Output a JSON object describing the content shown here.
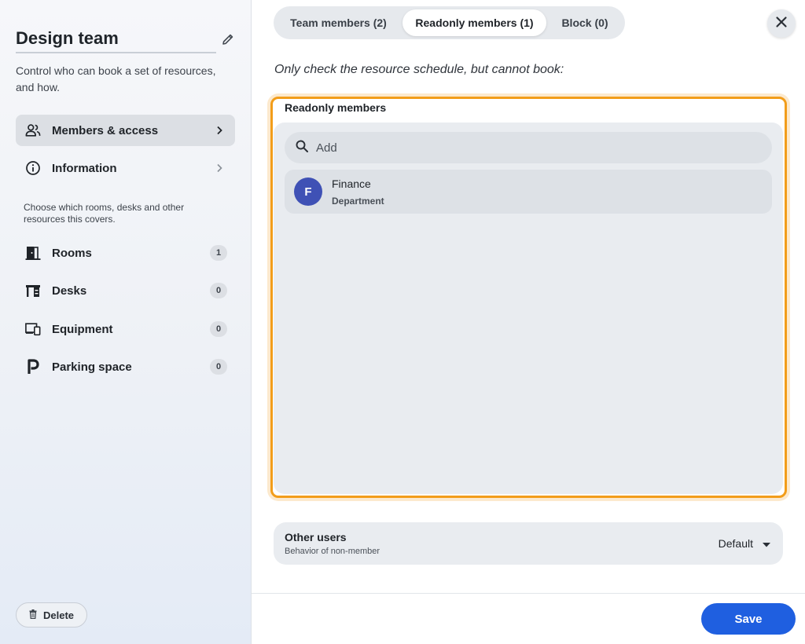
{
  "sidebar": {
    "title": "Design team",
    "subtitle": "Control who can book a set of resources, and how.",
    "nav": [
      {
        "label": "Members & access",
        "icon": "people-icon",
        "active": true
      },
      {
        "label": "Information",
        "icon": "info-icon",
        "active": false
      }
    ],
    "hint": "Choose which rooms, desks and other resources this covers.",
    "resources": [
      {
        "label": "Rooms",
        "count": "1",
        "icon": "door-icon"
      },
      {
        "label": "Desks",
        "count": "0",
        "icon": "desk-icon"
      },
      {
        "label": "Equipment",
        "count": "0",
        "icon": "devices-icon"
      },
      {
        "label": "Parking space",
        "count": "0",
        "icon": "parking-icon"
      }
    ],
    "delete_label": "Delete"
  },
  "tabs": [
    {
      "label": "Team members (2)",
      "active": false
    },
    {
      "label": "Readonly members (1)",
      "active": true
    },
    {
      "label": "Block (0)",
      "active": false
    }
  ],
  "main": {
    "instruction": "Only check the resource schedule, but cannot book:",
    "section_label": "Readonly members",
    "search_placeholder": "Add",
    "members": [
      {
        "initial": "F",
        "name": "Finance",
        "type": "Department",
        "avatar_color": "#3f51b5"
      }
    ],
    "other_users": {
      "title": "Other users",
      "subtitle": "Behavior of non-member",
      "value": "Default"
    },
    "save_label": "Save"
  },
  "colors": {
    "accent": "#1f5fe0",
    "highlight": "#f29d1a"
  }
}
